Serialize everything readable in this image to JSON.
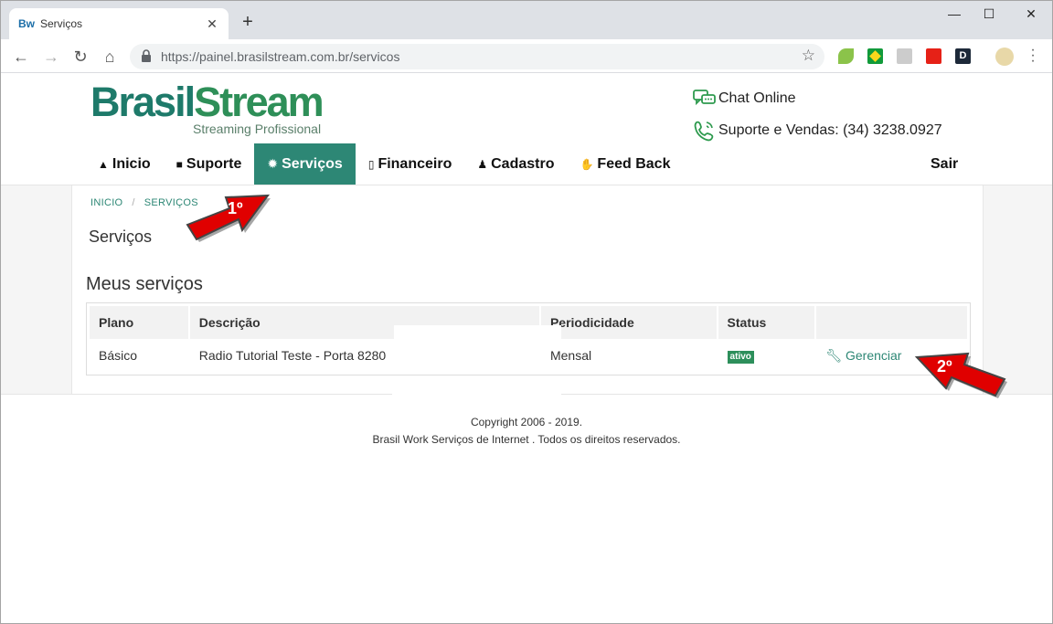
{
  "browser": {
    "tab_title": "Serviços",
    "favicon_text": "Bw",
    "url_host": "https://painel.brasilstream.com.br",
    "url_path": "/servicos"
  },
  "header": {
    "brand_part1": "Brasil",
    "brand_part2": "Stream",
    "tagline": "Streaming Profissional",
    "chat_label": "Chat Online",
    "support_label": "Suporte e Vendas: (34) 3238.0927"
  },
  "nav": {
    "items": [
      {
        "label": "Inicio",
        "icon": "home-icon"
      },
      {
        "label": "Suporte",
        "icon": "chat-icon"
      },
      {
        "label": "Serviços",
        "icon": "gear-icon"
      },
      {
        "label": "Financeiro",
        "icon": "document-icon"
      },
      {
        "label": "Cadastro",
        "icon": "users-icon"
      },
      {
        "label": "Feed Back",
        "icon": "thumbs-up-icon"
      }
    ],
    "logout": "Sair"
  },
  "breadcrumb": [
    "INICIO",
    "SERVIÇOS"
  ],
  "page_title": "Serviços",
  "section_title": "Meus serviços",
  "table": {
    "columns": [
      "Plano",
      "Descrição",
      "Periodicidade",
      "Status",
      ""
    ],
    "rows": [
      {
        "plano": "Básico",
        "descricao": "Radio Tutorial Teste - Porta 8280",
        "periodicidade": "Mensal",
        "status": "ativo",
        "action": "Gerenciar"
      }
    ]
  },
  "annotations": {
    "first": "1º",
    "second": "2º"
  },
  "footer": {
    "line1": "Copyright 2006 - 2019.",
    "line2": "Brasil Work Serviços de Internet . Todos os direitos reservados."
  },
  "colors": {
    "accent": "#2d8775",
    "status_badge": "#2d8f5b",
    "annotation_arrow": "#e00000"
  }
}
